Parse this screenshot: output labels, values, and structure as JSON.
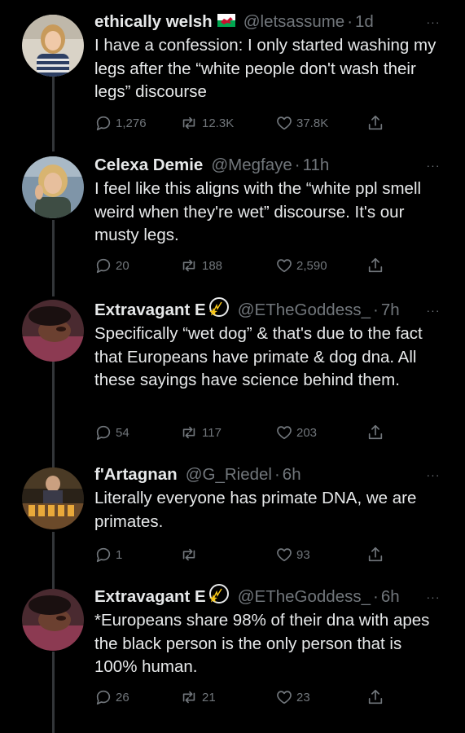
{
  "tweets": [
    {
      "name": "ethically welsh",
      "flag_emoji": "🏴󠁧󠁢󠁷󠁬󠁳󠁿",
      "handle": "@letsassume",
      "dot": "·",
      "time": "1d",
      "text": "I have a confession: I only started washing my legs after the “white people don't wash their legs” discourse",
      "replies": "1,276",
      "retweets": "12.3K",
      "likes": "37.8K"
    },
    {
      "name": "Celexa Demie",
      "handle": "@Megfaye",
      "dot": "·",
      "time": "11h",
      "text": "I feel like this aligns with the “white ppl smell weird when they're wet” discourse. It's our musty legs.",
      "replies": "20",
      "retweets": "188",
      "likes": "2,590"
    },
    {
      "name": "Extravagant E",
      "comet_emoji": "💫",
      "handle": "@ETheGoddess_",
      "dot": "·",
      "time": "7h",
      "text": "Specifically “wet dog” & that's due to the fact that Europeans have primate & dog dna. All these sayings have science behind them.",
      "replies": "54",
      "retweets": "117",
      "likes": "203"
    },
    {
      "name": "f'Artagnan",
      "handle": "@G_Riedel",
      "dot": "·",
      "time": "6h",
      "text": "Literally everyone has primate DNA, we are primates.",
      "replies": "1",
      "retweets": "",
      "likes": "93"
    },
    {
      "name": "Extravagant E",
      "comet_emoji": "💫",
      "handle": "@ETheGoddess_",
      "dot": "·",
      "time": "6h",
      "text": "*Europeans share 98% of their dna with apes the black person is the only person that is 100% human.",
      "replies": "26",
      "retweets": "21",
      "likes": "23"
    }
  ],
  "more_glyph": "···",
  "colors": {
    "background": "#000000",
    "text": "#e7e9ea",
    "secondary": "#71767b",
    "thread_line": "#333639",
    "welsh_red": "#c8102e",
    "welsh_green": "#00a650",
    "comet_yellow": "#f5c518"
  },
  "icons": [
    "reply-icon",
    "retweet-icon",
    "like-icon",
    "share-icon",
    "more-icon",
    "welsh-flag-icon",
    "dizzy-comet-icon"
  ]
}
